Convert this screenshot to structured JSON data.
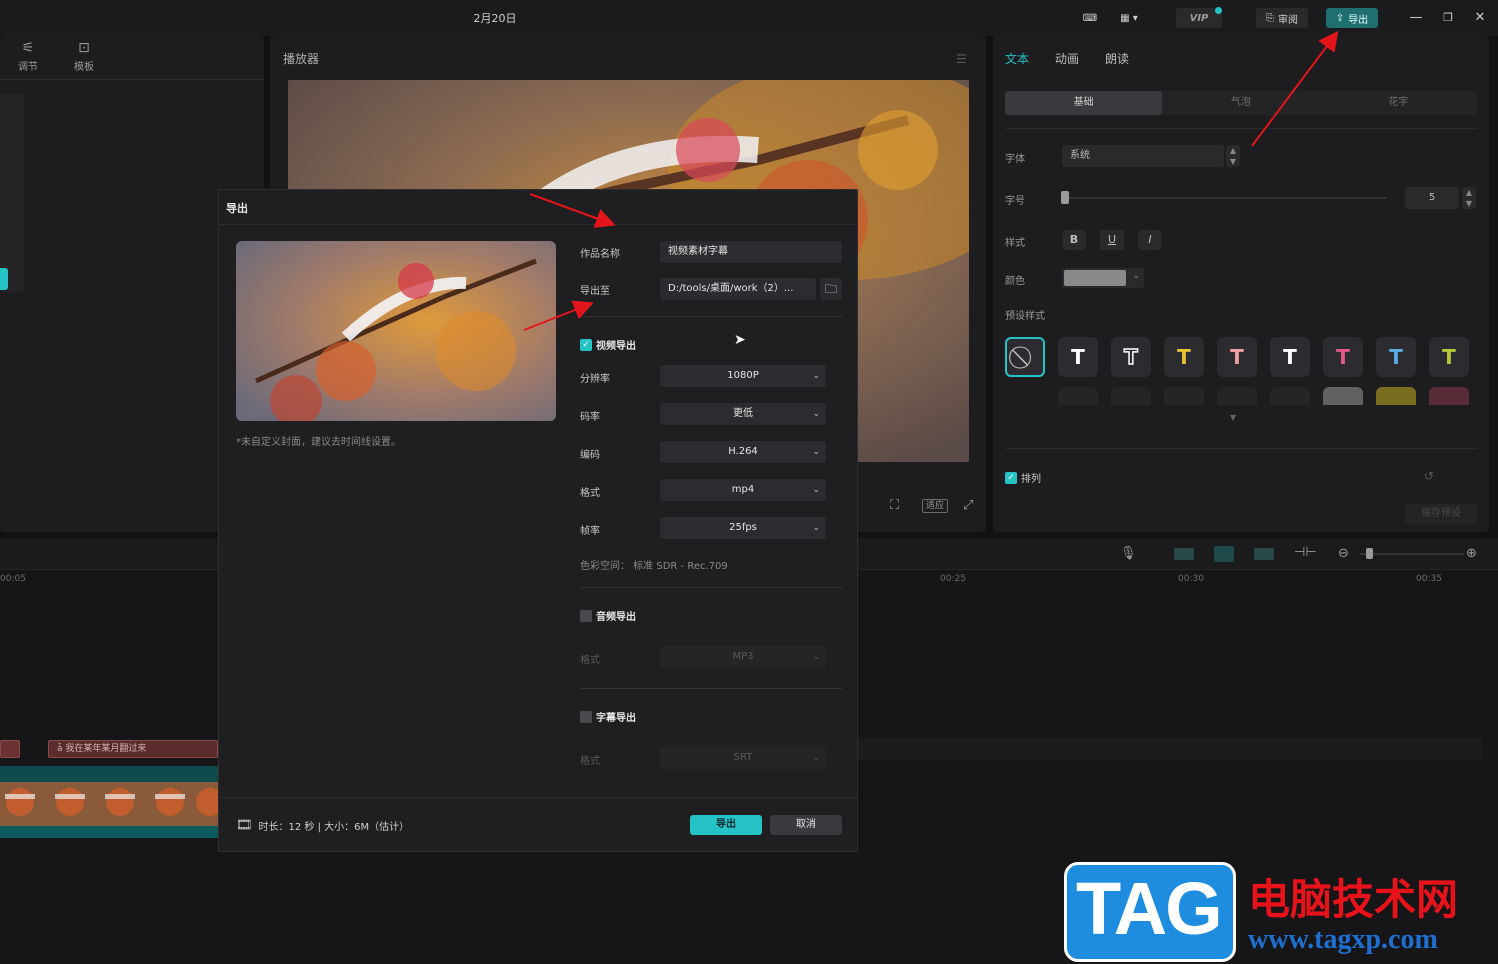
{
  "window": {
    "title": "2月20日"
  },
  "topbar": {
    "vip_label": "VIP",
    "review_label": "审阅",
    "export_label": "导出"
  },
  "left_panel": {
    "tabs": [
      {
        "label": "调节",
        "icon": "sliders-icon"
      },
      {
        "label": "模板",
        "icon": "template-icon"
      }
    ]
  },
  "player": {
    "title": "播放器",
    "fit_label": "适应"
  },
  "right_panel": {
    "tabs": [
      "文本",
      "动画",
      "朗读"
    ],
    "subtabs": [
      "基础",
      "气泡",
      "花字"
    ],
    "font_label": "字体",
    "font_value": "系统",
    "size_label": "字号",
    "size_value": "5",
    "style_label": "样式",
    "style_buttons": [
      "B",
      "U",
      "I"
    ],
    "color_label": "颜色",
    "preset_label": "预设样式",
    "arrange_label": "排列",
    "save_preset_label": "保存预设",
    "preset_colors": [
      "#ffffff",
      "#ffffff",
      "#e8c234",
      "#f0a0a0",
      "#ffffff",
      "#e65a8a",
      "#5ab0e6",
      "#b6c83a"
    ]
  },
  "timeline": {
    "ruler": [
      "00:05",
      "00:25",
      "00:30",
      "00:35"
    ],
    "subtitle_clip": "我在某年某月翻过来"
  },
  "dialog": {
    "title": "导出",
    "cover_note": "*未自定义封面，建议去时间线设置。",
    "name_label": "作品名称",
    "name_value": "视频素材字幕",
    "path_label": "导出至",
    "path_value": "D:/tools/桌面/work（2）...",
    "video_section": "视频导出",
    "resolution_label": "分辨率",
    "resolution_value": "1080P",
    "bitrate_label": "码率",
    "bitrate_value": "更低",
    "codec_label": "编码",
    "codec_value": "H.264",
    "format_label": "格式",
    "format_value": "mp4",
    "fps_label": "帧率",
    "fps_value": "25fps",
    "colorspace_text": "色彩空间：  标准 SDR - Rec.709",
    "audio_section": "音频导出",
    "audio_format_label": "格式",
    "audio_format_value": "MP3",
    "subtitle_section": "字幕导出",
    "subtitle_format_label": "格式",
    "subtitle_format_value": "SRT",
    "footer_info": "时长：12 秒 | 大小：6M（估计）",
    "export_button": "导出",
    "cancel_button": "取消"
  },
  "watermark": {
    "tag": "TAG",
    "cn": "电脑技术网",
    "url": "www.tagxp.com"
  },
  "colors": {
    "accent": "#25c2c6",
    "arrow": "#e3151a"
  }
}
